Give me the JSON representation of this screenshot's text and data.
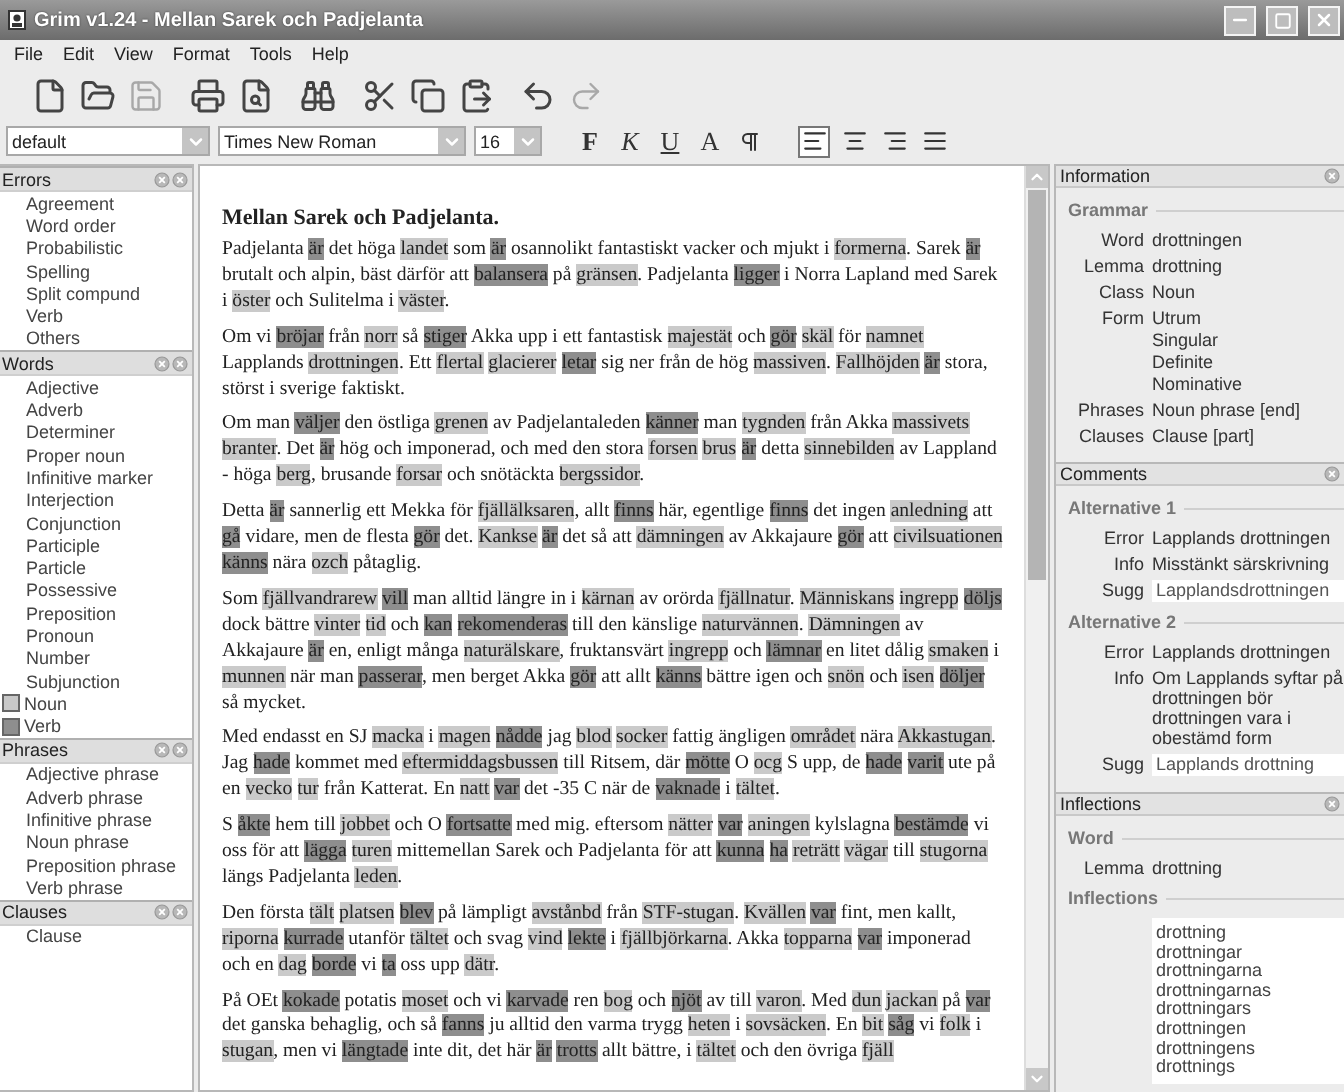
{
  "window": {
    "title": "Grim v1.24 - Mellan Sarek och Padjelanta"
  },
  "menu": [
    "File",
    "Edit",
    "View",
    "Format",
    "Tools",
    "Help"
  ],
  "toolbar": [
    [
      {
        "kind": "new",
        "disabled": false
      },
      {
        "kind": "open",
        "disabled": false
      },
      {
        "kind": "save",
        "disabled": true
      }
    ],
    [
      {
        "kind": "print",
        "disabled": false
      },
      {
        "kind": "preview",
        "disabled": false
      }
    ],
    [
      {
        "kind": "find",
        "disabled": false
      }
    ],
    [
      {
        "kind": "cut",
        "disabled": false
      },
      {
        "kind": "copy",
        "disabled": false
      },
      {
        "kind": "paste",
        "disabled": false
      }
    ],
    [
      {
        "kind": "undo",
        "disabled": false
      },
      {
        "kind": "redo",
        "disabled": true
      }
    ]
  ],
  "format_bar": {
    "style": "default",
    "font": "Times New Roman",
    "size": "16",
    "buttons": [
      {
        "label": "F",
        "kind": "bold"
      },
      {
        "label": "K",
        "kind": "italic"
      },
      {
        "label": "U",
        "kind": "underline"
      },
      {
        "label": "A",
        "kind": "color"
      }
    ],
    "alignment": [
      {
        "kind": "left",
        "selected": true
      },
      {
        "kind": "center",
        "selected": false
      },
      {
        "kind": "right",
        "selected": false
      },
      {
        "kind": "justify",
        "selected": false
      }
    ]
  },
  "sidebar": {
    "sections": [
      {
        "title": "Errors",
        "items": [
          {
            "label": "Agreement"
          },
          {
            "label": "Word order"
          },
          {
            "label": "Probabilistic"
          },
          {
            "label": "Spelling"
          },
          {
            "label": "Split compund"
          },
          {
            "label": "Verb"
          },
          {
            "label": "Others"
          }
        ]
      },
      {
        "title": "Words",
        "items": [
          {
            "label": "Adjective"
          },
          {
            "label": "Adverb"
          },
          {
            "label": "Determiner"
          },
          {
            "label": "Proper noun"
          },
          {
            "label": "Infinitive marker"
          },
          {
            "label": "Interjection"
          },
          {
            "label": "Conjunction"
          },
          {
            "label": "Participle"
          },
          {
            "label": "Particle"
          },
          {
            "label": "Possessive"
          },
          {
            "label": "Preposition"
          },
          {
            "label": "Pronoun"
          },
          {
            "label": "Number"
          },
          {
            "label": "Subjunction"
          },
          {
            "label": "Noun",
            "color": "#c8c8c8"
          },
          {
            "label": "Verb",
            "color": "#8e8e8e"
          }
        ]
      },
      {
        "title": "Phrases",
        "items": [
          {
            "label": "Adjective phrase"
          },
          {
            "label": "Adverb phrase"
          },
          {
            "label": "Infinitive phrase"
          },
          {
            "label": "Noun phrase"
          },
          {
            "label": "Preposition phrase"
          },
          {
            "label": "Verb phrase"
          }
        ]
      },
      {
        "title": "Clauses",
        "items": [
          {
            "label": "Clause"
          }
        ]
      }
    ]
  },
  "document": {
    "title": "Mellan Sarek och Padjelanta.",
    "paragraphs": [
      {
        "runs": [
          {
            "text": "Padjelanta ",
            "kind": "plain"
          },
          {
            "text": "är",
            "kind": "verb"
          },
          {
            "text": " det höga ",
            "kind": "plain"
          },
          {
            "text": "landet",
            "kind": "noun"
          },
          {
            "text": " som ",
            "kind": "plain"
          },
          {
            "text": "är",
            "kind": "verb"
          },
          {
            "text": " osannolikt fantastiskt vacker och mjukt i ",
            "kind": "plain"
          },
          {
            "text": "formerna",
            "kind": "noun"
          },
          {
            "text": ". Sarek ",
            "kind": "plain"
          },
          {
            "text": "är",
            "kind": "verb"
          },
          {
            "text": " brutalt och alpin, bäst därför att ",
            "kind": "plain"
          },
          {
            "text": "balansera",
            "kind": "verb"
          },
          {
            "text": " på ",
            "kind": "plain"
          },
          {
            "text": "gränsen",
            "kind": "noun"
          },
          {
            "text": ". Padjelanta ",
            "kind": "plain"
          },
          {
            "text": "ligger",
            "kind": "verb"
          },
          {
            "text": " i Norra Lapland med Sarek i ",
            "kind": "plain"
          },
          {
            "text": "öster",
            "kind": "noun"
          },
          {
            "text": " och Sulitelma i ",
            "kind": "plain"
          },
          {
            "text": "väster",
            "kind": "noun"
          },
          {
            "text": ".",
            "kind": "plain"
          }
        ]
      },
      {
        "runs": [
          {
            "text": "Om vi ",
            "kind": "plain"
          },
          {
            "text": "bröjar",
            "kind": "verb"
          },
          {
            "text": " från ",
            "kind": "plain"
          },
          {
            "text": "norr",
            "kind": "noun"
          },
          {
            "text": " så ",
            "kind": "plain"
          },
          {
            "text": "stiger",
            "kind": "verb"
          },
          {
            "text": " Akka upp i ett fantastisk ",
            "kind": "plain"
          },
          {
            "text": "majestät",
            "kind": "noun"
          },
          {
            "text": " och ",
            "kind": "plain"
          },
          {
            "text": "gör ",
            "kind": "verb"
          },
          {
            "text": "skäl",
            "kind": "noun"
          },
          {
            "text": " för ",
            "kind": "plain"
          },
          {
            "text": "namnet",
            "kind": "noun"
          },
          {
            "text": " Lapplands ",
            "kind": "plain"
          },
          {
            "text": "drottningen",
            "kind": "noun"
          },
          {
            "text": ". Ett ",
            "kind": "plain"
          },
          {
            "text": "flertal ",
            "kind": "noun"
          },
          {
            "text": "glacierer ",
            "kind": "noun"
          },
          {
            "text": "letar",
            "kind": "verb"
          },
          {
            "text": " sig ner från de hög ",
            "kind": "plain"
          },
          {
            "text": "massiven",
            "kind": "noun"
          },
          {
            "text": ". ",
            "kind": "plain"
          },
          {
            "text": "Fallhöjden ",
            "kind": "noun"
          },
          {
            "text": "är",
            "kind": "verb"
          },
          {
            "text": " stora, störst i sverige faktiskt.",
            "kind": "plain"
          }
        ]
      },
      {
        "runs": [
          {
            "text": "Om man ",
            "kind": "plain"
          },
          {
            "text": "väljer",
            "kind": "verb"
          },
          {
            "text": " den östliga ",
            "kind": "plain"
          },
          {
            "text": "grenen",
            "kind": "noun"
          },
          {
            "text": " av Padjelantaleden ",
            "kind": "plain"
          },
          {
            "text": "känner",
            "kind": "verb"
          },
          {
            "text": " man ",
            "kind": "plain"
          },
          {
            "text": "tygnden",
            "kind": "noun"
          },
          {
            "text": " från Akka ",
            "kind": "plain"
          },
          {
            "text": "massivets ",
            "kind": "noun"
          },
          {
            "text": "branter",
            "kind": "noun"
          },
          {
            "text": ". Det ",
            "kind": "plain"
          },
          {
            "text": "är",
            "kind": "verb"
          },
          {
            "text": " hög och imponerad, och med den stora ",
            "kind": "plain"
          },
          {
            "text": "forsen ",
            "kind": "noun"
          },
          {
            "text": "brus ",
            "kind": "noun"
          },
          {
            "text": "är",
            "kind": "verb"
          },
          {
            "text": " detta ",
            "kind": "plain"
          },
          {
            "text": "sinnebilden",
            "kind": "noun"
          },
          {
            "text": " av Lappland - höga ",
            "kind": "plain"
          },
          {
            "text": "berg",
            "kind": "noun"
          },
          {
            "text": ", brusande ",
            "kind": "plain"
          },
          {
            "text": "forsar",
            "kind": "noun"
          },
          {
            "text": " och snötäckta ",
            "kind": "plain"
          },
          {
            "text": "bergssidor",
            "kind": "noun"
          },
          {
            "text": ".",
            "kind": "plain"
          }
        ]
      },
      {
        "runs": [
          {
            "text": "Detta ",
            "kind": "plain"
          },
          {
            "text": "är",
            "kind": "verb"
          },
          {
            "text": " sannerlig ett Mekka för ",
            "kind": "plain"
          },
          {
            "text": "fjällälksaren",
            "kind": "noun"
          },
          {
            "text": ", allt ",
            "kind": "plain"
          },
          {
            "text": "finns",
            "kind": "verb"
          },
          {
            "text": " här, egentlige ",
            "kind": "plain"
          },
          {
            "text": "finns",
            "kind": "verb"
          },
          {
            "text": " det ingen ",
            "kind": "plain"
          },
          {
            "text": "anledning",
            "kind": "noun"
          },
          {
            "text": " att ",
            "kind": "plain"
          },
          {
            "text": "gå",
            "kind": "verb"
          },
          {
            "text": " vidare, men de flesta ",
            "kind": "plain"
          },
          {
            "text": "gör",
            "kind": "verb"
          },
          {
            "text": " det. ",
            "kind": "plain"
          },
          {
            "text": "Kankse ",
            "kind": "noun"
          },
          {
            "text": "är",
            "kind": "verb"
          },
          {
            "text": " det så att ",
            "kind": "plain"
          },
          {
            "text": "dämningen",
            "kind": "noun"
          },
          {
            "text": " av Akkajaure ",
            "kind": "plain"
          },
          {
            "text": "gör",
            "kind": "verb"
          },
          {
            "text": " att ",
            "kind": "plain"
          },
          {
            "text": "civilsuationen ",
            "kind": "noun"
          },
          {
            "text": "känns",
            "kind": "verb"
          },
          {
            "text": " nära ",
            "kind": "plain"
          },
          {
            "text": "ozch",
            "kind": "noun"
          },
          {
            "text": " påtaglig.",
            "kind": "plain"
          }
        ]
      },
      {
        "runs": [
          {
            "text": "Som ",
            "kind": "plain"
          },
          {
            "text": "fjällvandrarew ",
            "kind": "noun"
          },
          {
            "text": "vill",
            "kind": "verb"
          },
          {
            "text": " man alltid längre in i ",
            "kind": "plain"
          },
          {
            "text": "kärnan",
            "kind": "noun"
          },
          {
            "text": " av orörda ",
            "kind": "plain"
          },
          {
            "text": "fjällnatur",
            "kind": "noun"
          },
          {
            "text": ". ",
            "kind": "plain"
          },
          {
            "text": "Människans ",
            "kind": "noun"
          },
          {
            "text": "ingrepp ",
            "kind": "noun"
          },
          {
            "text": "döljs",
            "kind": "verb"
          },
          {
            "text": " dock bättre ",
            "kind": "plain"
          },
          {
            "text": "vinter ",
            "kind": "noun"
          },
          {
            "text": "tid",
            "kind": "noun"
          },
          {
            "text": " och ",
            "kind": "plain"
          },
          {
            "text": "kan ",
            "kind": "verb"
          },
          {
            "text": "rekomenderas",
            "kind": "verb"
          },
          {
            "text": " till den känslige ",
            "kind": "plain"
          },
          {
            "text": "naturvännen",
            "kind": "noun"
          },
          {
            "text": ". ",
            "kind": "plain"
          },
          {
            "text": "Dämningen",
            "kind": "noun"
          },
          {
            "text": " av Akkajaure ",
            "kind": "plain"
          },
          {
            "text": "är",
            "kind": "verb"
          },
          {
            "text": " en, enligt många ",
            "kind": "plain"
          },
          {
            "text": "naturälskare",
            "kind": "noun"
          },
          {
            "text": ", fruktansvärt ",
            "kind": "plain"
          },
          {
            "text": "ingrepp",
            "kind": "noun"
          },
          {
            "text": " och ",
            "kind": "plain"
          },
          {
            "text": "lämnar",
            "kind": "verb"
          },
          {
            "text": " en litet dålig ",
            "kind": "plain"
          },
          {
            "text": "smaken",
            "kind": "noun"
          },
          {
            "text": " i ",
            "kind": "plain"
          },
          {
            "text": "munnen",
            "kind": "noun"
          },
          {
            "text": " när man ",
            "kind": "plain"
          },
          {
            "text": "passerar",
            "kind": "verb"
          },
          {
            "text": ", men berget Akka ",
            "kind": "plain"
          },
          {
            "text": "gör",
            "kind": "verb"
          },
          {
            "text": " att allt ",
            "kind": "plain"
          },
          {
            "text": "känns",
            "kind": "verb"
          },
          {
            "text": " bättre igen och ",
            "kind": "plain"
          },
          {
            "text": "snön",
            "kind": "noun"
          },
          {
            "text": " och ",
            "kind": "plain"
          },
          {
            "text": "isen ",
            "kind": "noun"
          },
          {
            "text": "döljer",
            "kind": "verb"
          },
          {
            "text": " så mycket.",
            "kind": "plain"
          }
        ]
      },
      {
        "runs": [
          {
            "text": "Med endasst en SJ ",
            "kind": "plain"
          },
          {
            "text": "macka",
            "kind": "noun"
          },
          {
            "text": " i ",
            "kind": "plain"
          },
          {
            "text": "magen ",
            "kind": "noun"
          },
          {
            "text": "nådde",
            "kind": "verb"
          },
          {
            "text": " jag ",
            "kind": "plain"
          },
          {
            "text": "blod ",
            "kind": "noun"
          },
          {
            "text": "socker",
            "kind": "noun"
          },
          {
            "text": " fattig ängligen ",
            "kind": "plain"
          },
          {
            "text": "området",
            "kind": "noun"
          },
          {
            "text": " nära ",
            "kind": "plain"
          },
          {
            "text": "Akkastugan",
            "kind": "noun"
          },
          {
            "text": ". Jag ",
            "kind": "plain"
          },
          {
            "text": "hade",
            "kind": "verb"
          },
          {
            "text": " kommet med ",
            "kind": "plain"
          },
          {
            "text": "eftermiddagsbussen",
            "kind": "noun"
          },
          {
            "text": " till Ritsem, där ",
            "kind": "plain"
          },
          {
            "text": "mötte",
            "kind": "verb"
          },
          {
            "text": " O ",
            "kind": "plain"
          },
          {
            "text": "ocg",
            "kind": "noun"
          },
          {
            "text": " S upp, de ",
            "kind": "plain"
          },
          {
            "text": "hade ",
            "kind": "verb"
          },
          {
            "text": "varit",
            "kind": "verb"
          },
          {
            "text": " ute på en ",
            "kind": "plain"
          },
          {
            "text": "vecko ",
            "kind": "noun"
          },
          {
            "text": "tur",
            "kind": "noun"
          },
          {
            "text": " från Katterat. En ",
            "kind": "plain"
          },
          {
            "text": "natt ",
            "kind": "noun"
          },
          {
            "text": "var",
            "kind": "verb"
          },
          {
            "text": " det -35 C när de ",
            "kind": "plain"
          },
          {
            "text": "vaknade",
            "kind": "verb"
          },
          {
            "text": " i ",
            "kind": "plain"
          },
          {
            "text": "tältet",
            "kind": "noun"
          },
          {
            "text": ".",
            "kind": "plain"
          }
        ]
      },
      {
        "runs": [
          {
            "text": "S ",
            "kind": "plain"
          },
          {
            "text": "åkte",
            "kind": "verb"
          },
          {
            "text": " hem till ",
            "kind": "plain"
          },
          {
            "text": "jobbet",
            "kind": "noun"
          },
          {
            "text": " och O ",
            "kind": "plain"
          },
          {
            "text": "fortsatte",
            "kind": "verb"
          },
          {
            "text": " med mig. eftersom ",
            "kind": "plain"
          },
          {
            "text": "nätter ",
            "kind": "noun"
          },
          {
            "text": "var ",
            "kind": "verb"
          },
          {
            "text": "aningen",
            "kind": "noun"
          },
          {
            "text": " kylslagna ",
            "kind": "plain"
          },
          {
            "text": "bestämde",
            "kind": "verb"
          },
          {
            "text": " vi oss för att ",
            "kind": "plain"
          },
          {
            "text": "lägga ",
            "kind": "verb"
          },
          {
            "text": "turen",
            "kind": "noun"
          },
          {
            "text": " mittemellan Sarek och Padjelanta för att ",
            "kind": "plain"
          },
          {
            "text": "kunna ",
            "kind": "verb"
          },
          {
            "text": "ha ",
            "kind": "verb"
          },
          {
            "text": "reträtt ",
            "kind": "noun"
          },
          {
            "text": "vägar",
            "kind": "noun"
          },
          {
            "text": " till ",
            "kind": "plain"
          },
          {
            "text": "stugorna",
            "kind": "noun"
          },
          {
            "text": " längs Padjelanta ",
            "kind": "plain"
          },
          {
            "text": "leden",
            "kind": "noun"
          },
          {
            "text": ".",
            "kind": "plain"
          }
        ]
      },
      {
        "runs": [
          {
            "text": "Den första ",
            "kind": "plain"
          },
          {
            "text": "tält ",
            "kind": "noun"
          },
          {
            "text": "platsen ",
            "kind": "noun"
          },
          {
            "text": "blev",
            "kind": "verb"
          },
          {
            "text": " på lämpligt ",
            "kind": "plain"
          },
          {
            "text": "avstånbd",
            "kind": "noun"
          },
          {
            "text": " från ",
            "kind": "plain"
          },
          {
            "text": "STF-stugan",
            "kind": "noun"
          },
          {
            "text": ". ",
            "kind": "plain"
          },
          {
            "text": "Kvällen ",
            "kind": "noun"
          },
          {
            "text": "var",
            "kind": "verb"
          },
          {
            "text": " fint, men kallt, ",
            "kind": "plain"
          },
          {
            "text": "riporna ",
            "kind": "noun"
          },
          {
            "text": "kurrade",
            "kind": "verb"
          },
          {
            "text": " utanför ",
            "kind": "plain"
          },
          {
            "text": "tältet",
            "kind": "noun"
          },
          {
            "text": " och svag ",
            "kind": "plain"
          },
          {
            "text": "vind ",
            "kind": "noun"
          },
          {
            "text": "lekte",
            "kind": "verb"
          },
          {
            "text": " i ",
            "kind": "plain"
          },
          {
            "text": "fjällbjörkarna",
            "kind": "noun"
          },
          {
            "text": ". Akka ",
            "kind": "plain"
          },
          {
            "text": "topparna ",
            "kind": "noun"
          },
          {
            "text": "var",
            "kind": "verb"
          },
          {
            "text": " imponerad och en ",
            "kind": "plain"
          },
          {
            "text": "dag ",
            "kind": "noun"
          },
          {
            "text": "borde",
            "kind": "verb"
          },
          {
            "text": " vi ",
            "kind": "plain"
          },
          {
            "text": "ta",
            "kind": "verb"
          },
          {
            "text": " oss upp ",
            "kind": "plain"
          },
          {
            "text": "dätr",
            "kind": "noun"
          },
          {
            "text": ".",
            "kind": "plain"
          }
        ]
      },
      {
        "runs": [
          {
            "text": "På OEt ",
            "kind": "plain"
          },
          {
            "text": "kokade",
            "kind": "verb"
          },
          {
            "text": " potatis ",
            "kind": "plain"
          },
          {
            "text": "moset",
            "kind": "noun"
          },
          {
            "text": " och vi ",
            "kind": "plain"
          },
          {
            "text": "karvade",
            "kind": "verb"
          },
          {
            "text": " ren ",
            "kind": "plain"
          },
          {
            "text": "bog",
            "kind": "noun"
          },
          {
            "text": " och ",
            "kind": "plain"
          },
          {
            "text": "njöt",
            "kind": "verb"
          },
          {
            "text": " av till ",
            "kind": "plain"
          },
          {
            "text": "varon",
            "kind": "noun"
          },
          {
            "text": ". Med ",
            "kind": "plain"
          },
          {
            "text": "dun ",
            "kind": "noun"
          },
          {
            "text": "jackan",
            "kind": "noun"
          },
          {
            "text": " på ",
            "kind": "plain"
          },
          {
            "text": "var",
            "kind": "verb"
          },
          {
            "text": " det ganska behaglig, och så ",
            "kind": "plain"
          },
          {
            "text": "fanns",
            "kind": "verb"
          },
          {
            "text": " ju alltid den varma trygg ",
            "kind": "plain"
          },
          {
            "text": "heten",
            "kind": "noun"
          },
          {
            "text": " i ",
            "kind": "plain"
          },
          {
            "text": "sovsäcken",
            "kind": "noun"
          },
          {
            "text": ". En ",
            "kind": "plain"
          },
          {
            "text": "bit ",
            "kind": "noun"
          },
          {
            "text": "såg",
            "kind": "verb"
          },
          {
            "text": " vi ",
            "kind": "plain"
          },
          {
            "text": "folk",
            "kind": "noun"
          },
          {
            "text": " i ",
            "kind": "plain"
          },
          {
            "text": "stugan",
            "kind": "noun"
          },
          {
            "text": ", men vi ",
            "kind": "plain"
          },
          {
            "text": "längtade",
            "kind": "verb"
          },
          {
            "text": " inte dit, det här ",
            "kind": "plain"
          },
          {
            "text": "är ",
            "kind": "verb"
          },
          {
            "text": "trotts",
            "kind": "verb"
          },
          {
            "text": " allt bättre, i ",
            "kind": "plain"
          },
          {
            "text": "tältet",
            "kind": "noun"
          },
          {
            "text": " och den övriga ",
            "kind": "plain"
          },
          {
            "text": "fjäll",
            "kind": "noun"
          }
        ]
      }
    ]
  },
  "information": {
    "title": "Information",
    "group": "Grammar",
    "rows": [
      {
        "label": "Word",
        "values": [
          "drottningen"
        ]
      },
      {
        "label": "Lemma",
        "values": [
          "drottning"
        ]
      },
      {
        "label": "Class",
        "values": [
          "Noun"
        ]
      },
      {
        "label": "Form",
        "values": [
          "Utrum",
          "Singular",
          "Definite",
          "Nominative"
        ]
      },
      {
        "label": "Phrases",
        "values": [
          "Noun phrase [end]"
        ]
      },
      {
        "label": "Clauses",
        "values": [
          "Clause [part]"
        ]
      }
    ]
  },
  "comments": {
    "title": "Comments",
    "alternatives": [
      {
        "title": "Alternative 1",
        "rows": [
          {
            "label": "Error",
            "value": "Lapplands drottningen",
            "kind": "text"
          },
          {
            "label": "Info",
            "value": "Misstänkt särskrivning",
            "kind": "text"
          },
          {
            "label": "Sugg",
            "value": "Lapplandsdrottningen",
            "kind": "field"
          }
        ]
      },
      {
        "title": "Alternative 2",
        "rows": [
          {
            "label": "Error",
            "value": "Lapplands drottningen",
            "kind": "text"
          },
          {
            "label": "Info",
            "value": "Om Lapplands syftar på drottningen bör drottningen vara i obestämd form",
            "kind": "text"
          },
          {
            "label": "Sugg",
            "value": "Lapplands drottning",
            "kind": "field"
          }
        ]
      }
    ]
  },
  "inflections": {
    "title": "Inflections",
    "word_group": "Word",
    "rows": [
      {
        "label": "Lemma",
        "value": "drottning"
      }
    ],
    "list_group": "Inflections",
    "forms": [
      "drottning",
      "drottningar",
      "drottningarna",
      "drottningarnas",
      "drottningars",
      "drottningen",
      "drottningens",
      "drottnings"
    ]
  }
}
